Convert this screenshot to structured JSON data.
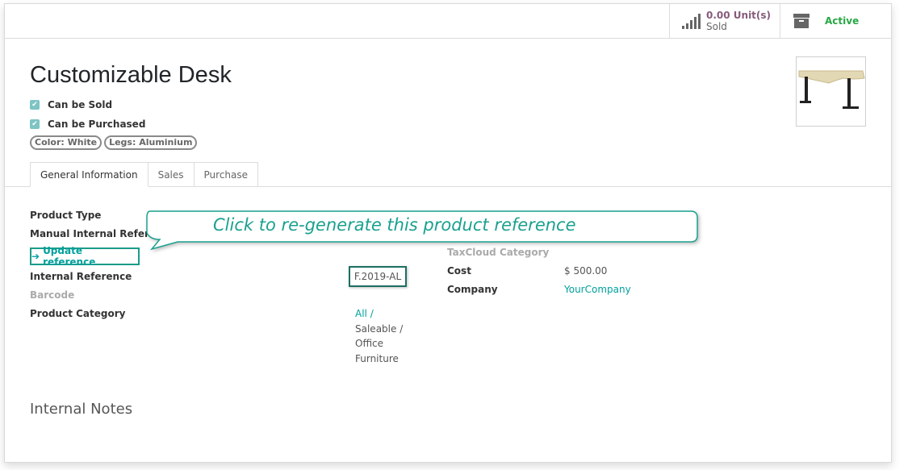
{
  "stats": {
    "sold_value": "0.00 Unit(s)",
    "sold_label": "Sold",
    "active_label": "Active"
  },
  "product": {
    "title": "Customizable Desk",
    "can_be_sold": "Can be Sold",
    "can_be_purchased": "Can be Purchased",
    "tags": [
      "Color: White",
      "Legs: Aluminium"
    ]
  },
  "tabs": [
    "General Information",
    "Sales",
    "Purchase"
  ],
  "fields": {
    "product_type": "Product Type",
    "manual_ref": "Manual Internal Reference",
    "update_button": "Update reference",
    "internal_ref_label": "Internal Reference",
    "internal_ref_value": "F.2019-AL",
    "barcode": "Barcode",
    "product_category": "Product Category",
    "category_lines": [
      "All /",
      "Saleable /",
      "Office",
      "Furniture"
    ],
    "taxcloud": "TaxCloud Category",
    "cost_label": "Cost",
    "cost_value": "$ 500.00",
    "company_label": "Company",
    "company_value": "YourCompany"
  },
  "internal_notes": "Internal Notes",
  "tooltip": "Click to re-generate this product reference",
  "colors": {
    "accent": "#00a09d",
    "active": "#28a745",
    "stat": "#875a7b"
  }
}
